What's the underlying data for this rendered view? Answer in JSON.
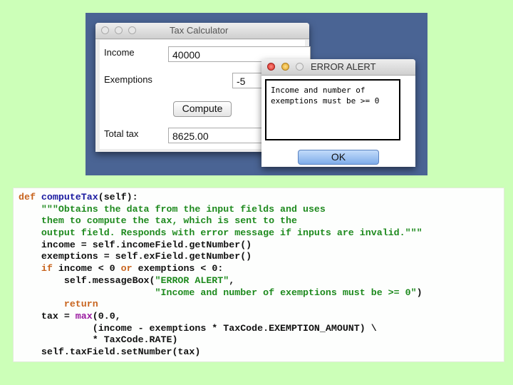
{
  "tax_window": {
    "title": "Tax Calculator",
    "income_label": "Income",
    "income_value": "40000",
    "exemptions_label": "Exemptions",
    "exemptions_value": "-5",
    "compute_label": "Compute",
    "total_label": "Total tax",
    "total_value": "8625.00"
  },
  "alert_window": {
    "title": "ERROR ALERT",
    "message_line1": "Income and number of",
    "message_line2": "exemptions must be >= 0",
    "ok_label": "OK"
  },
  "colors": {
    "desktop": "#4a6494",
    "keyword": "#c8641e",
    "function": "#1a1aa0",
    "string": "#1e8a1e",
    "builtin": "#9a1aa0",
    "ok_button": "#8fb8ee"
  },
  "code_lines": [
    [
      [
        "kw",
        "def "
      ],
      [
        "fn",
        "computeTax"
      ],
      [
        "",
        "(self):"
      ]
    ],
    [
      [
        "",
        "    "
      ],
      [
        "str",
        "\"\"\"Obtains the data from the input fields and uses"
      ]
    ],
    [
      [
        "",
        "    "
      ],
      [
        "str",
        "them to compute the tax, which is sent to the"
      ]
    ],
    [
      [
        "",
        "    "
      ],
      [
        "str",
        "output field. Responds with error message if inputs are invalid.\"\"\""
      ]
    ],
    [
      [
        "",
        "    income = self.incomeField.getNumber()"
      ]
    ],
    [
      [
        "",
        "    exemptions = self.exField.getNumber()"
      ]
    ],
    [
      [
        "",
        "    "
      ],
      [
        "kw",
        "if"
      ],
      [
        "",
        " income < 0 "
      ],
      [
        "kw",
        "or"
      ],
      [
        "",
        " exemptions < 0:"
      ]
    ],
    [
      [
        "",
        "        self.messageBox("
      ],
      [
        "str",
        "\"ERROR ALERT\""
      ],
      [
        "",
        ","
      ]
    ],
    [
      [
        "",
        "                        "
      ],
      [
        "str",
        "\"Income and number of exemptions must be >= 0\""
      ],
      [
        "",
        ")"
      ]
    ],
    [
      [
        "",
        "        "
      ],
      [
        "kw",
        "return"
      ]
    ],
    [
      [
        "",
        "    tax = "
      ],
      [
        "bi",
        "max"
      ],
      [
        "",
        "(0.0,"
      ]
    ],
    [
      [
        "",
        "             (income - exemptions * TaxCode.EXEMPTION_AMOUNT) \\"
      ]
    ],
    [
      [
        "",
        "             * TaxCode.RATE)"
      ]
    ],
    [
      [
        "",
        "    self.taxField.setNumber(tax)"
      ]
    ]
  ]
}
